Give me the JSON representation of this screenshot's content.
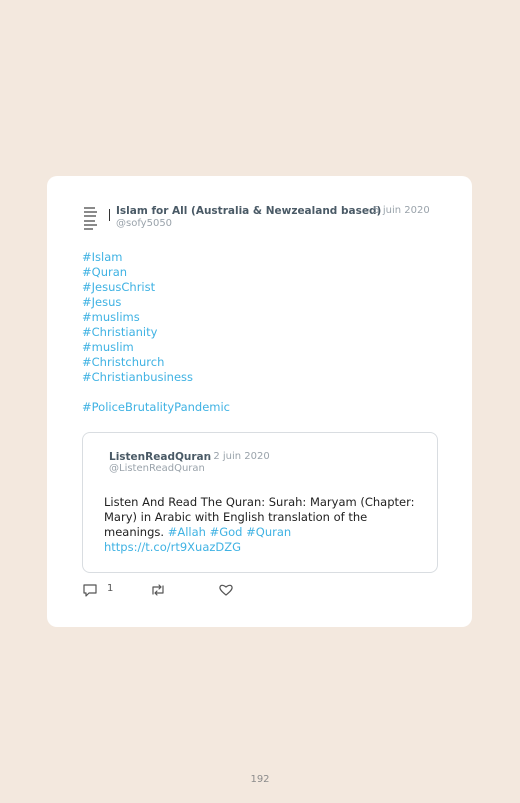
{
  "tweet": {
    "author_name": "Islam for All (Australia & Newzealand based)",
    "date": "· 5 juin 2020",
    "handle": "@sofy5050",
    "hashtags": [
      "#Islam",
      "#Quran",
      "#JesusChrist",
      "#Jesus",
      "#muslims",
      "#Christianity",
      "#muslim",
      "#Christchurch",
      "#Christianbusiness"
    ],
    "extra_hashtag": "#PoliceBrutalityPandemic",
    "reply_count": "1"
  },
  "quoted": {
    "author_name": "ListenReadQuran",
    "date": "· 2 juin 2020",
    "handle": "@ListenReadQuran",
    "text": "Listen And Read The Quran: Surah: Maryam (Chapter: Mary) in Arabic with English translation of the meanings. ",
    "tags": [
      "#Allah",
      "#God",
      "#Quran"
    ],
    "url": "https://t.co/rt9XuazDZG"
  },
  "page_number": "192",
  "colors": {
    "background": "#f3e8de",
    "link": "#3fb2e3"
  }
}
